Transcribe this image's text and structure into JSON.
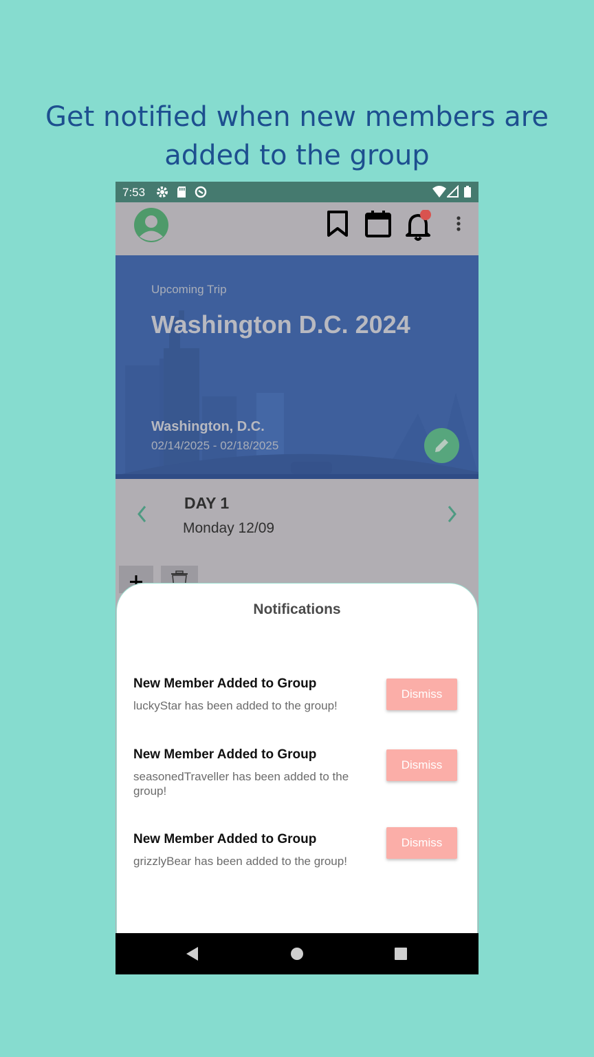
{
  "promo": {
    "line1": "Get notified when new members are",
    "line2": "added to the group"
  },
  "status_bar": {
    "time": "7:53",
    "icons": [
      "gear-icon",
      "sd-card-icon",
      "data-saver-icon",
      "wifi-icon",
      "signal-icon",
      "battery-icon"
    ]
  },
  "app_bar": {
    "icons": [
      "avatar-icon",
      "bookmark-icon",
      "calendar-icon",
      "bell-icon",
      "more-vert-icon"
    ],
    "notification_dot_color": "#d9534f"
  },
  "trip": {
    "label": "Upcoming Trip",
    "title": "Washington D.C. 2024",
    "location": "Washington, D.C.",
    "dates": "02/14/2025 - 02/18/2025"
  },
  "day": {
    "title": "DAY 1",
    "date": "Monday 12/09"
  },
  "notifications": {
    "header": "Notifications",
    "items": [
      {
        "title": "New Member Added to Group",
        "body": "luckyStar has been added to the group!",
        "action": "Dismiss"
      },
      {
        "title": "New Member Added to Group",
        "body": "seasonedTraveller has been added to the group!",
        "action": "Dismiss"
      },
      {
        "title": "New Member Added to Group",
        "body": "grizzlyBear has been added to the group!",
        "action": "Dismiss"
      }
    ]
  },
  "colors": {
    "background": "#86dccf",
    "promo_text": "#1d4f8f",
    "status_bar": "#457a6f",
    "hero": "#3e5f9c",
    "accent_green": "#57a67d",
    "dismiss_button": "#fbaea8"
  }
}
